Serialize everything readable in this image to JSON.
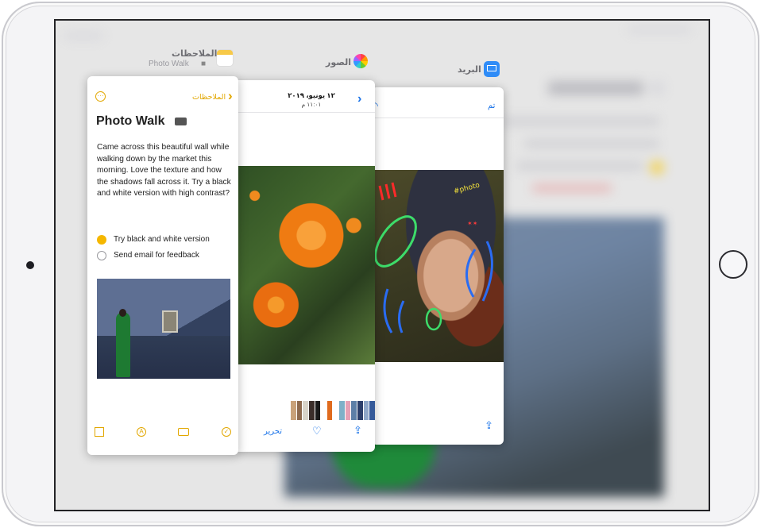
{
  "app_switcher": {
    "notes": {
      "app_name": "الملاحظات",
      "note_subtitle": "Photo Walk"
    },
    "photos": {
      "app_name": "الصور"
    },
    "mail": {
      "app_name": "البريد"
    }
  },
  "notes_card": {
    "back_label": "الملاحظات",
    "title": "Photo Walk",
    "body": "Came across this beautiful wall while walking down by the market this morning. Love the texture and how the shadows fall across it. Try a black and white version with high contrast?",
    "checklist": [
      {
        "label": "Try black and white version",
        "checked": true
      },
      {
        "label": "Send email for feedback",
        "checked": false
      }
    ],
    "toolbar_icons": [
      "compose-icon",
      "markup-icon",
      "camera-icon",
      "checklist-icon"
    ]
  },
  "photos_card": {
    "date": "١٢ يونيو، ٢٠١٩",
    "time": "١١:٠١ م",
    "edit_label": "تحرير"
  },
  "mail_card": {
    "done_label": "تم"
  },
  "colors": {
    "notes_accent": "#e2a700",
    "ios_blue": "#1a73e8"
  }
}
